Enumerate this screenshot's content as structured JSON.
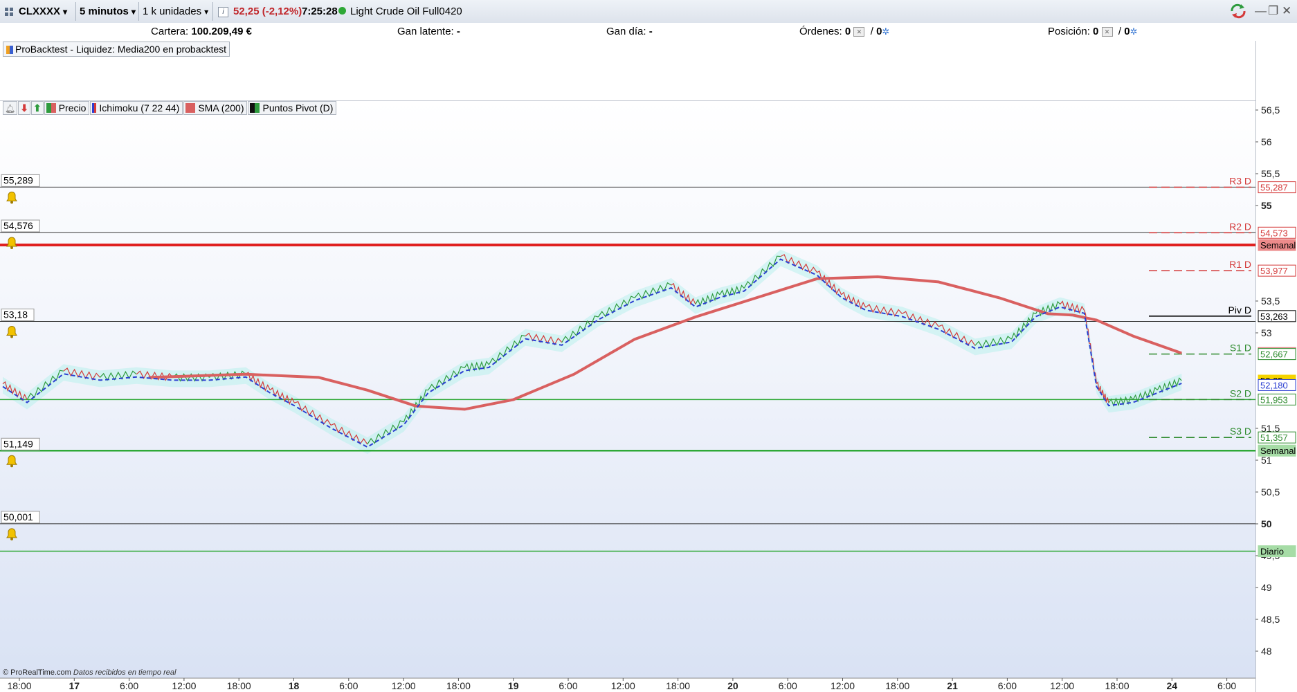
{
  "toolbar": {
    "symbol": "CLXXXX",
    "timeframe": "5 minutos",
    "units": "1 k unidades",
    "info_icon": "i",
    "price_change": "52,25 (-2,12%)",
    "time": "7:25:28",
    "instrument": "Light Crude Oil Full0420",
    "status_color": "#2ea836"
  },
  "infobar": {
    "cartera_label": "Cartera:",
    "cartera_value": "100.209,49 €",
    "gan_latente_label": "Gan latente:",
    "gan_latente_value": "-",
    "gan_dia_label": "Gan día:",
    "gan_dia_value": "-",
    "ordenes_label": "Órdenes:",
    "ordenes_value": "0",
    "ordenes_value2": "0",
    "posicion_label": "Posición:",
    "posicion_value": "0",
    "posicion_value2": "0"
  },
  "probacktest": {
    "label": "ProBacktest - Liquidez: Media200 en probacktest"
  },
  "legend": [
    {
      "label": "Precio",
      "color": "#2e9b3e"
    },
    {
      "label": "Ichimoku (7 22 44)",
      "color": "#2b3fd1"
    },
    {
      "label": "SMA (200)",
      "color": "#d96060"
    },
    {
      "label": "Puntos Pivot (D)",
      "color": "#111111"
    }
  ],
  "alert_levels": [
    {
      "label": "55,289",
      "price": 55.289
    },
    {
      "label": "54,576",
      "price": 54.576
    },
    {
      "label": "53,18",
      "price": 53.18
    },
    {
      "label": "51,149",
      "price": 51.149
    },
    {
      "label": "50,001",
      "price": 50.001
    }
  ],
  "y_axis": {
    "ticks": [
      "56,5",
      "56",
      "55,5",
      "55",
      "53,5",
      "53",
      "51,5",
      "51",
      "50,5",
      "50",
      "49,5",
      "49",
      "48,5",
      "48"
    ],
    "tick_values": [
      56.5,
      56,
      55.5,
      55,
      53.5,
      53,
      51.5,
      51,
      50.5,
      50,
      49.5,
      49,
      48.5,
      48
    ],
    "bold_ticks": [
      "55",
      "50"
    ]
  },
  "price_tags": [
    {
      "text": "55,287",
      "price": 55.287,
      "color": "#d43a3a"
    },
    {
      "text": "54,573",
      "price": 54.573,
      "color": "#d43a3a"
    },
    {
      "text": "Semanal",
      "price": 54.38,
      "color": "#000000",
      "bg": "#ec8b8b"
    },
    {
      "text": "53,977",
      "price": 53.977,
      "color": "#d43a3a"
    },
    {
      "text": "53,263",
      "price": 53.263,
      "color": "#000000"
    },
    {
      "text": "52,682",
      "price": 52.682,
      "color": "#d96060"
    },
    {
      "text": "52,667",
      "price": 52.667,
      "color": "#2e8b2e"
    },
    {
      "text": "52,25",
      "price": 52.25,
      "color": "#000000",
      "bg": "#f5d400"
    },
    {
      "text": "52,180",
      "price": 52.18,
      "color": "#2b3fd1"
    },
    {
      "text": "51,953",
      "price": 51.953,
      "color": "#2e8b2e"
    },
    {
      "text": "51,357",
      "price": 51.357,
      "color": "#2e8b2e"
    },
    {
      "text": "Semanal",
      "price": 51.15,
      "color": "#000000",
      "bg": "#a6dca6"
    },
    {
      "text": "Diario",
      "price": 49.57,
      "color": "#000000",
      "bg": "#a6dca6"
    }
  ],
  "pivots": [
    {
      "label": "R3 D",
      "price": 55.287,
      "color": "#d43a3a"
    },
    {
      "label": "R2 D",
      "price": 54.573,
      "color": "#d43a3a"
    },
    {
      "label": "R1 D",
      "price": 53.977,
      "color": "#d43a3a"
    },
    {
      "label": "Piv D",
      "price": 53.263,
      "color": "#000000"
    },
    {
      "label": "S1 D",
      "price": 52.667,
      "color": "#2e8b2e"
    },
    {
      "label": "S2 D",
      "price": 51.953,
      "color": "#2e8b2e"
    },
    {
      "label": "S3 D",
      "price": 51.357,
      "color": "#2e8b2e"
    }
  ],
  "x_axis": {
    "labels": [
      "18:00",
      "17",
      "6:00",
      "12:00",
      "18:00",
      "18",
      "6:00",
      "12:00",
      "18:00",
      "19",
      "6:00",
      "12:00",
      "18:00",
      "20",
      "6:00",
      "12:00",
      "18:00",
      "21",
      "6:00",
      "12:00",
      "18:00",
      "24",
      "6:00"
    ],
    "bold": [
      "17",
      "18",
      "19",
      "20",
      "21",
      "24"
    ]
  },
  "chart_data": {
    "type": "line",
    "instrument": "Light Crude Oil Full0420",
    "last_price": 52.25,
    "ylim": [
      47.6,
      56.7
    ],
    "series": [
      {
        "name": "Precio",
        "x": [
          0,
          0.02,
          0.05,
          0.08,
          0.11,
          0.14,
          0.17,
          0.2,
          0.22,
          0.24,
          0.27,
          0.3,
          0.33,
          0.35,
          0.38,
          0.4,
          0.43,
          0.46,
          0.49,
          0.52,
          0.55,
          0.57,
          0.59,
          0.61,
          0.64,
          0.67,
          0.69,
          0.71,
          0.74,
          0.77,
          0.8,
          0.83,
          0.85,
          0.87,
          0.89,
          0.9,
          0.91,
          0.93,
          0.95,
          0.97
        ],
        "values": [
          52.2,
          51.95,
          52.4,
          52.3,
          52.35,
          52.3,
          52.3,
          52.35,
          52.1,
          51.9,
          51.55,
          51.25,
          51.6,
          52.1,
          52.45,
          52.5,
          52.95,
          52.85,
          53.25,
          53.55,
          53.75,
          53.45,
          53.6,
          53.7,
          54.2,
          53.95,
          53.6,
          53.4,
          53.3,
          53.1,
          52.8,
          52.9,
          53.3,
          53.45,
          53.35,
          52.2,
          51.9,
          51.95,
          52.1,
          52.25
        ]
      },
      {
        "name": "SMA (200)",
        "x": [
          0.12,
          0.2,
          0.26,
          0.3,
          0.34,
          0.38,
          0.42,
          0.47,
          0.52,
          0.57,
          0.62,
          0.67,
          0.72,
          0.77,
          0.82,
          0.86,
          0.88,
          0.9,
          0.93,
          0.97
        ],
        "values": [
          52.3,
          52.35,
          52.3,
          52.1,
          51.85,
          51.8,
          51.95,
          52.35,
          52.9,
          53.25,
          53.55,
          53.85,
          53.88,
          53.8,
          53.55,
          53.3,
          53.28,
          53.2,
          52.95,
          52.68
        ]
      }
    ]
  },
  "footer": {
    "source": "© ProRealTime.com",
    "note": "Datos recibidos en tiempo real"
  }
}
